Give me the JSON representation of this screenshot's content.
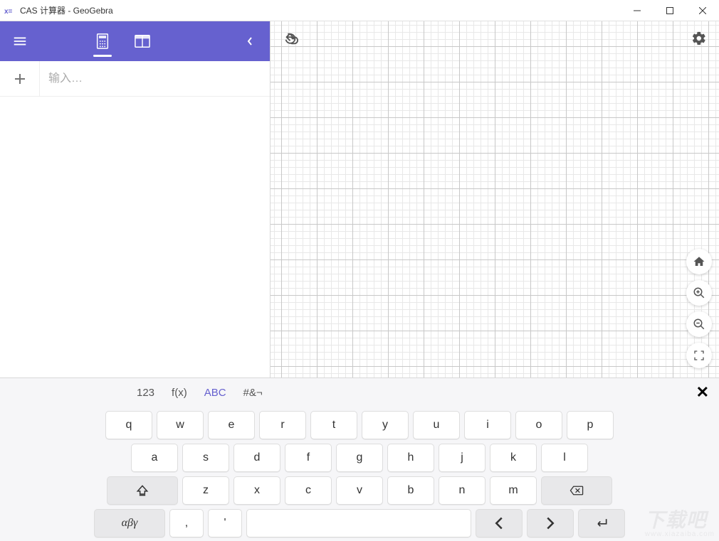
{
  "window": {
    "title": "CAS 计算器 - GeoGebra"
  },
  "input": {
    "placeholder": "输入…"
  },
  "keyboard": {
    "tabs": {
      "num": "123",
      "fx": "f(x)",
      "abc": "ABC",
      "sym": "#&¬"
    },
    "row1": {
      "k0": "q",
      "k1": "w",
      "k2": "e",
      "k3": "r",
      "k4": "t",
      "k5": "y",
      "k6": "u",
      "k7": "i",
      "k8": "o",
      "k9": "p"
    },
    "row2": {
      "k0": "a",
      "k1": "s",
      "k2": "d",
      "k3": "f",
      "k4": "g",
      "k5": "h",
      "k6": "j",
      "k7": "k",
      "k8": "l"
    },
    "row3": {
      "k0": "z",
      "k1": "x",
      "k2": "c",
      "k3": "v",
      "k4": "b",
      "k5": "n",
      "k6": "m"
    },
    "row4": {
      "greek": "αβγ",
      "comma": ",",
      "apos": "'"
    }
  },
  "watermark": {
    "text": "下载吧",
    "url": "www.xiazaiba.com"
  }
}
